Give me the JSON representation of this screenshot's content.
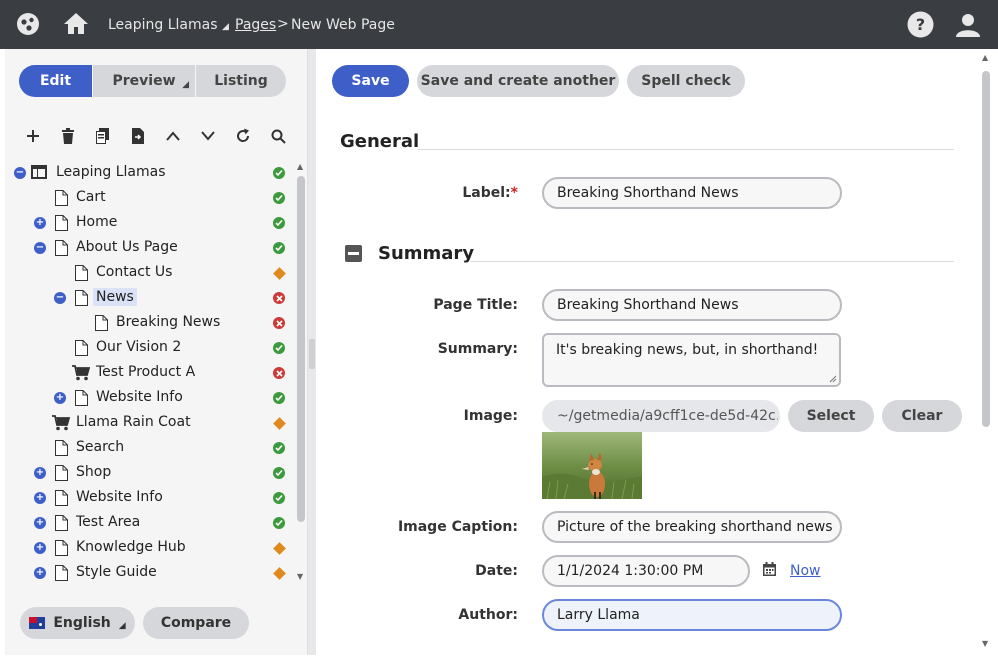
{
  "topbar": {
    "site_name": "Leaping Llamas",
    "breadcrumb_link": "Pages",
    "breadcrumb_separator": ">",
    "breadcrumb_current": "New Web Page",
    "icons": [
      "app-logo-icon",
      "home-icon",
      "help-icon",
      "user-icon"
    ]
  },
  "left": {
    "modes": {
      "edit": "Edit",
      "preview": "Preview",
      "listing": "Listing"
    },
    "toolbar_icons": [
      "add-icon",
      "delete-icon",
      "copy-icon",
      "move-icon",
      "move-up-icon",
      "move-down-icon",
      "refresh-icon",
      "search-icon"
    ],
    "tree": [
      {
        "label": "Leaping Llamas",
        "status": "ok"
      },
      {
        "label": "Cart",
        "status": "ok"
      },
      {
        "label": "Home",
        "status": "ok"
      },
      {
        "label": "About Us Page",
        "status": "ok"
      },
      {
        "label": "Contact Us",
        "status": "warn"
      },
      {
        "label": "News",
        "status": "err"
      },
      {
        "label": "Breaking News",
        "status": "err"
      },
      {
        "label": "Our Vision 2",
        "status": "ok"
      },
      {
        "label": "Test Product A",
        "status": "err"
      },
      {
        "label": "Website Info",
        "status": "ok"
      },
      {
        "label": "Llama Rain Coat",
        "status": "warn"
      },
      {
        "label": "Search",
        "status": "ok"
      },
      {
        "label": "Shop",
        "status": "ok"
      },
      {
        "label": "Website Info",
        "status": "ok"
      },
      {
        "label": "Test Area",
        "status": "ok"
      },
      {
        "label": "Knowledge Hub",
        "status": "warn"
      },
      {
        "label": "Style Guide",
        "status": "warn"
      }
    ],
    "language": "English",
    "compare": "Compare",
    "status_colors": {
      "ok": "#3b9a3b",
      "err": "#cc3a3a",
      "warn": "#e08a1e"
    }
  },
  "main": {
    "buttons": {
      "save": "Save",
      "save_another": "Save and create another",
      "spell": "Spell check"
    },
    "general_heading": "General",
    "summary_heading": "Summary",
    "fields": {
      "label": {
        "label": "Label:",
        "required": "*",
        "value": "Breaking Shorthand News"
      },
      "page_title": {
        "label": "Page Title:",
        "value": "Breaking Shorthand News"
      },
      "summary": {
        "label": "Summary:",
        "value": "It's breaking news, but, in shorthand!"
      },
      "image": {
        "label": "Image:",
        "value": "~/getmedia/a9cff1ce-de5d-42c...",
        "select": "Select",
        "clear": "Clear"
      },
      "image_caption": {
        "label": "Image Caption:",
        "value": "Picture of the breaking shorthand news"
      },
      "date": {
        "label": "Date:",
        "value": "1/1/2024 1:30:00 PM",
        "now": "Now"
      },
      "author": {
        "label": "Author:",
        "value": "Larry Llama"
      }
    }
  }
}
